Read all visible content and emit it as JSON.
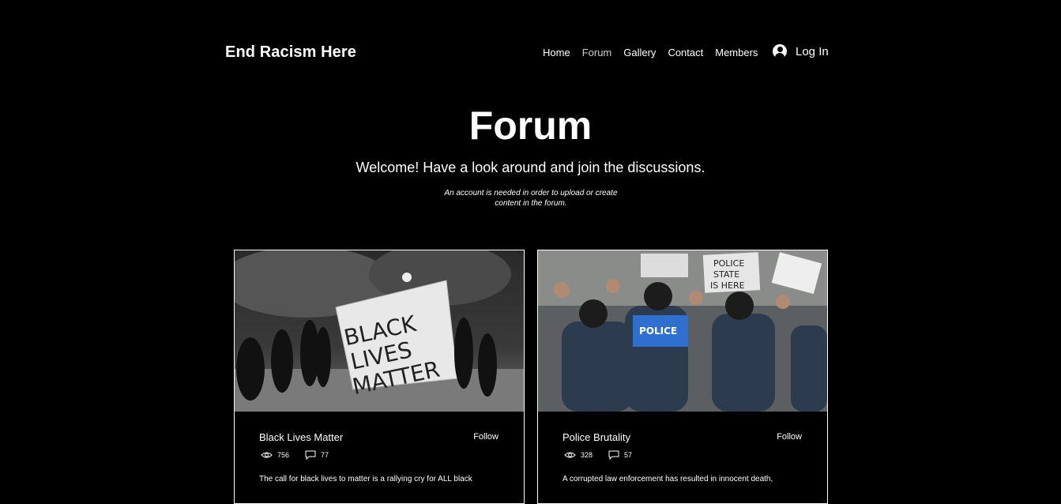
{
  "header": {
    "site_title": "End Racism Here",
    "nav": [
      "Home",
      "Forum",
      "Gallery",
      "Contact",
      "Members"
    ],
    "active_nav": "Forum",
    "login_label": "Log In"
  },
  "hero": {
    "title": "Forum",
    "subtitle": "Welcome! Have a look around and join the discussions.",
    "note_line1": "An account is needed in order to upload or create",
    "note_line2": "content in the forum."
  },
  "categories": [
    {
      "title": "Black Lives Matter",
      "follow_label": "Follow",
      "views": "756",
      "comments": "77",
      "description": "The call for black lives to matter is a rallying cry for ALL black",
      "image_banner_text": [
        "BLACK",
        "LIVES",
        "MATTER"
      ]
    },
    {
      "title": "Police Brutality",
      "follow_label": "Follow",
      "views": "328",
      "comments": "57",
      "description": "A corrupted law enforcement has resulted in innocent death,",
      "image_sign_text": [
        "POLICE",
        "STATE",
        "IS HERE"
      ],
      "image_vest_text": "POLICE"
    }
  ],
  "colors": {
    "background": "#000000",
    "text": "#ffffff"
  }
}
